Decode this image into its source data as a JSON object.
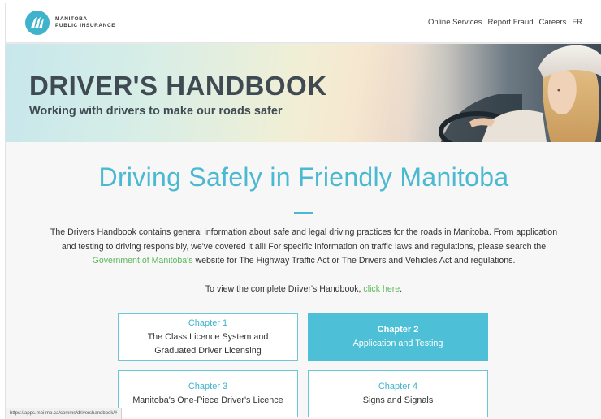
{
  "header": {
    "logo_line1": "MANITOBA",
    "logo_line2": "PUBLIC INSURANCE",
    "nav": [
      "Online Services",
      "Report Fraud",
      "Careers",
      "FR"
    ]
  },
  "hero": {
    "title": "DRIVER'S HANDBOOK",
    "subtitle": "Working with drivers to make our roads safer"
  },
  "main": {
    "title": "Driving Safely in Friendly Manitoba",
    "intro_part1": "The Drivers Handbook contains general information about safe and legal driving practices for the roads in Manitoba. From application and testing to driving responsibly, we've covered it all! For specific information on traffic laws and regulations, please search the ",
    "intro_link": "Government of Manitoba's",
    "intro_part2": " website for The Highway Traffic Act or The Drivers and Vehicles Act and regulations.",
    "view_text": "To view the complete Driver's Handbook, ",
    "view_link": "click here",
    "view_end": "."
  },
  "chapters": [
    {
      "label": "Chapter 1",
      "desc_line1": "The Class Licence System and",
      "desc_line2": "Graduated Driver Licensing"
    },
    {
      "label": "Chapter 2",
      "desc_line1": "Application and Testing",
      "desc_line2": ""
    },
    {
      "label": "Chapter 3",
      "desc_line1": "Manitoba's One-Piece Driver's Licence",
      "desc_line2": ""
    },
    {
      "label": "Chapter 4",
      "desc_line1": "Signs and Signals",
      "desc_line2": ""
    }
  ],
  "status_url": "https://apps.mpi.mb.ca/comms/drivershandbook/#",
  "colors": {
    "accent": "#4ab9d1",
    "link": "#5cb85c",
    "active_card": "#4dbfd6"
  }
}
